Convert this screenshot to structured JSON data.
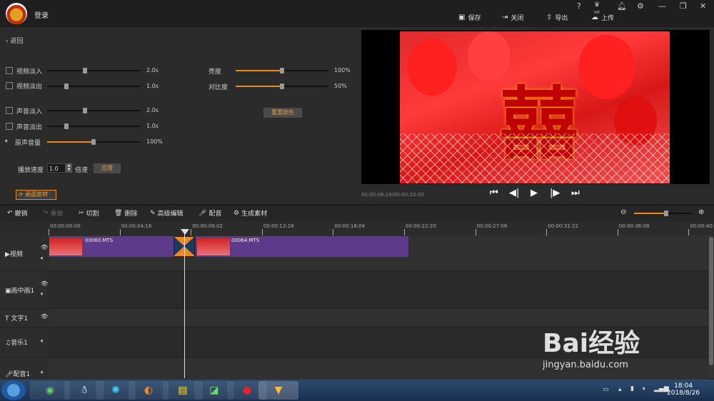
{
  "app": {
    "login": "登录"
  },
  "topbar": {
    "icons": [
      "help-icon",
      "vip-icon",
      "bell-icon",
      "gear-icon",
      "minimize-icon",
      "maximize-icon",
      "close-icon"
    ],
    "vip_label": "VIP",
    "save": "保存",
    "close": "关闭",
    "export": "导出",
    "upload": "上传"
  },
  "left": {
    "back": "返回",
    "rows": [
      {
        "label": "视频淡入",
        "value": "2.0s",
        "level": 0.4
      },
      {
        "label": "视频淡出",
        "value": "1.0s",
        "level": 0.2
      },
      {
        "label": "声音淡入",
        "value": "2.0s",
        "level": 0.4
      },
      {
        "label": "声音淡出",
        "value": "1.0s",
        "level": 0.2
      },
      {
        "label": "原声音量",
        "value": "100%",
        "level": 0.5
      }
    ],
    "brightness": {
      "label": "亮度",
      "value": "100%",
      "level": 0.5
    },
    "contrast": {
      "label": "对比度",
      "value": "50%",
      "level": 0.5
    },
    "reset_color": "重置颜色",
    "speed_label": "播放速度",
    "speed_value": "1.0",
    "speed_unit": "倍速",
    "apply": "应用",
    "rotate": "画面旋转"
  },
  "preview": {
    "timecode": "00:00:08:19/00:00:23:00"
  },
  "toolbar": {
    "undo": "撤销",
    "redo": "重做",
    "cut": "切割",
    "delete": "删除",
    "advanced": "高级编辑",
    "dub": "配音",
    "gen": "生成素材",
    "zoom_level": 0.55
  },
  "ruler": [
    "00:00:00:00",
    "00:00:04:16",
    "00:00:09:02",
    "00:00:13:18",
    "00:00:18:04",
    "00:00:22:20",
    "00:00:27:06",
    "00:00:31:22",
    "00:00:36:08",
    "00:00:40:"
  ],
  "tracks": {
    "video": "视频",
    "pip": "画中画1",
    "text": "文字1",
    "music": "音乐1",
    "voice": "配音1"
  },
  "clips": {
    "clip1": "00060.MTS",
    "clip2": "00064.MTS"
  },
  "clock": {
    "time": "18:04",
    "date": "2018/8/26"
  },
  "watermark": {
    "brand": "Bai经验",
    "url": "jingyan.baidu.com"
  }
}
